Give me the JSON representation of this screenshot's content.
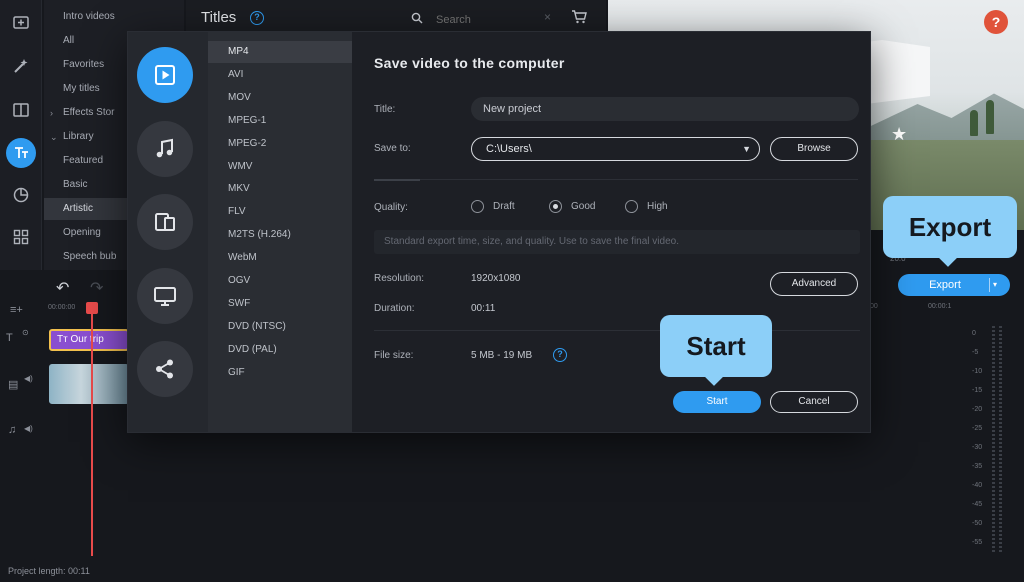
{
  "app": {
    "library": {
      "items": [
        {
          "label": "Intro videos",
          "chevron": ""
        },
        {
          "label": "All",
          "chevron": ""
        },
        {
          "label": "Favorites",
          "chevron": ""
        },
        {
          "label": "My titles",
          "chevron": ""
        },
        {
          "label": "Effects Stor",
          "chevron": "›"
        },
        {
          "label": "Library",
          "chevron": "⌄"
        },
        {
          "label": "Featured",
          "chevron": ""
        },
        {
          "label": "Basic",
          "chevron": ""
        },
        {
          "label": "Artistic",
          "chevron": ""
        },
        {
          "label": "Opening",
          "chevron": ""
        },
        {
          "label": "Speech bub",
          "chevron": ""
        }
      ],
      "active_index": 8
    },
    "titles_header": {
      "title": "Titles",
      "help": "?",
      "search_placeholder": "Search",
      "clear": "×"
    },
    "preview": {
      "help": "?",
      "star": "★"
    },
    "timeline": {
      "ruler_start": "00:00:00",
      "ruler_right_1": "00",
      "ruler_right_2": "00:00:1",
      "zoom": "20.0",
      "title_clip_label": "Our trip",
      "title_clip_icon": "Tт",
      "project_length": "Project length: 00:11",
      "scale": [
        "0",
        "-5",
        "-10",
        "-15",
        "-20",
        "-25",
        "-30",
        "-35",
        "-40",
        "-45",
        "-50",
        "-55"
      ]
    },
    "export_button": {
      "label": "Export",
      "dropdown": "▾"
    }
  },
  "dialog": {
    "title": "Save video to the computer",
    "formats": [
      "MP4",
      "AVI",
      "MOV",
      "MPEG-1",
      "MPEG-2",
      "WMV",
      "MKV",
      "FLV",
      "M2TS (H.264)",
      "WebM",
      "OGV",
      "SWF",
      "DVD (NTSC)",
      "DVD (PAL)",
      "GIF"
    ],
    "active_format_index": 0,
    "fields": {
      "title_label": "Title:",
      "title_value": "New project",
      "save_to_label": "Save to:",
      "save_to_value": "C:\\Users\\",
      "browse_label": "Browse",
      "quality_label": "Quality:",
      "quality_options": [
        "Draft",
        "Good",
        "High"
      ],
      "quality_selected": "Good",
      "quality_description": "Standard export time, size, and quality. Use to save the final video.",
      "resolution_label": "Resolution:",
      "resolution_value": "1920x1080",
      "advanced_label": "Advanced",
      "duration_label": "Duration:",
      "duration_value": "00:11",
      "file_size_label": "File size:",
      "file_size_value": "5 MB - 19 MB",
      "file_size_info": "?"
    },
    "start_label": "Start",
    "cancel_label": "Cancel"
  },
  "callouts": {
    "export": "Export",
    "start": "Start"
  },
  "colors": {
    "accent": "#2f9bf0",
    "callout": "#8ccff8",
    "playhead": "#e84b4b",
    "title_clip": "#8a4fd0"
  }
}
